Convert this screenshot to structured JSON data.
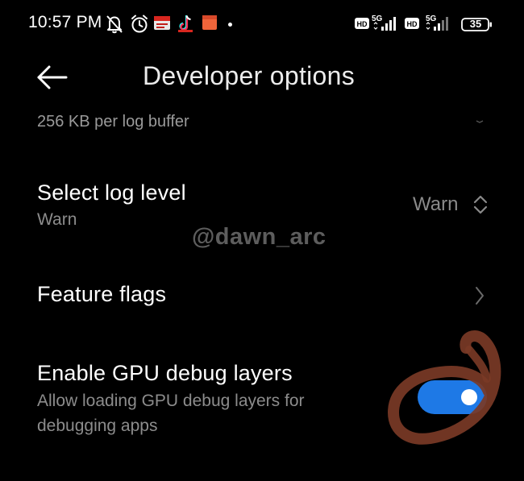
{
  "status_bar": {
    "time": "10:57 PM",
    "network_1": "5G",
    "network_2": "5G",
    "hd_1": "HD",
    "hd_2": "HD",
    "battery": "35",
    "icons": [
      "bell-off-icon",
      "alarm-icon",
      "news-app-icon",
      "tiktok-icon",
      "note-app-icon",
      "dot-icon",
      "signal-icon",
      "battery-icon"
    ]
  },
  "header": {
    "title": "Developer options",
    "back_icon": "arrow-left-icon"
  },
  "settings": {
    "log_buffer_summary": "256 KB per log buffer",
    "log_level": {
      "title": "Select log level",
      "subtitle": "Warn",
      "value": "Warn"
    },
    "feature_flags": {
      "title": "Feature flags"
    },
    "gpu_debug": {
      "title": "Enable GPU debug layers",
      "subtitle": "Allow loading GPU debug layers for debugging apps",
      "enabled": true
    }
  },
  "overlay": {
    "watermark": "@dawn_arc"
  },
  "colors": {
    "background": "#000000",
    "accent": "#1e79e6",
    "scribble": "#7a3a26",
    "secondary_text": "#8c8c8c"
  }
}
